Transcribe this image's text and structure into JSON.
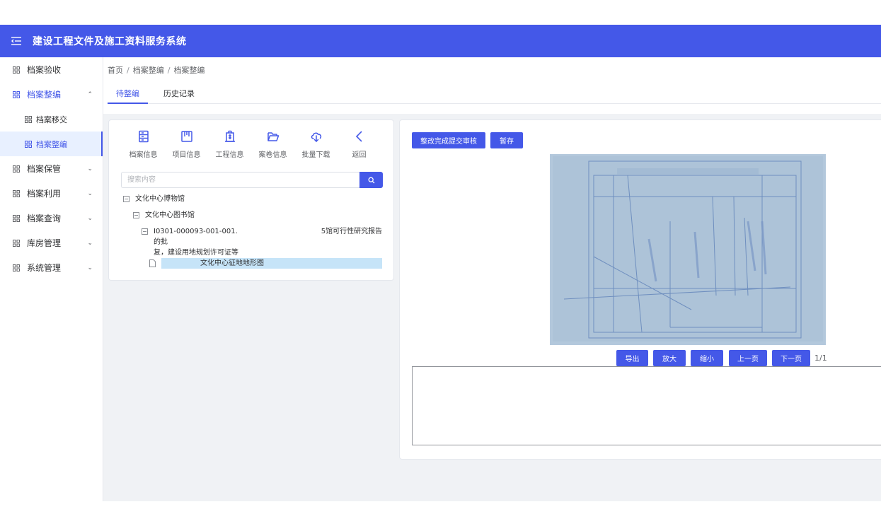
{
  "header": {
    "title": "建设工程文件及施工资料服务系统",
    "menu_icon": "menu-fold-icon"
  },
  "sidebar": {
    "items": [
      {
        "label": "档案验收",
        "expandable": false
      },
      {
        "label": "档案整编",
        "expanded": true,
        "children": [
          "档案移交",
          "档案整编"
        ]
      },
      {
        "label": "档案保管"
      },
      {
        "label": "档案利用"
      },
      {
        "label": "档案查询"
      },
      {
        "label": "库房管理"
      },
      {
        "label": "系统管理"
      }
    ]
  },
  "breadcrumb": {
    "home": "首页",
    "level1": "档案整编",
    "level2": "档案整编"
  },
  "tabs": {
    "pending": "待整编",
    "history": "历史记录"
  },
  "toolbar": {
    "archive_info": "档案信息",
    "project_info": "项目信息",
    "engineering_info": "工程信息",
    "volume_info": "案卷信息",
    "batch_download": "批量下载",
    "back": "返回"
  },
  "search": {
    "placeholder": "搜索内容",
    "value": ""
  },
  "tree": {
    "node1": "文化中心博物馆",
    "node2": "文化中心图书馆",
    "node3_line1": "I0301-000093-001-001.",
    "node3_line1_right": "5馆可行性研究报告的批",
    "node3_line2": "复，建设用地规划许可证等",
    "node4": "文化中心征地地形图"
  },
  "actions": {
    "submit_review": "整改完成提交审核",
    "save_draft": "暂存"
  },
  "viewer": {
    "export": "导出",
    "zoom_in": "放大",
    "zoom_out": "缩小",
    "prev_page": "上一页",
    "next_page": "下一页",
    "page_indicator": "1/1"
  },
  "colors": {
    "accent": "#4458e8",
    "selected_bg": "#c6e4f8",
    "page_bg": "#f0f2f5"
  }
}
